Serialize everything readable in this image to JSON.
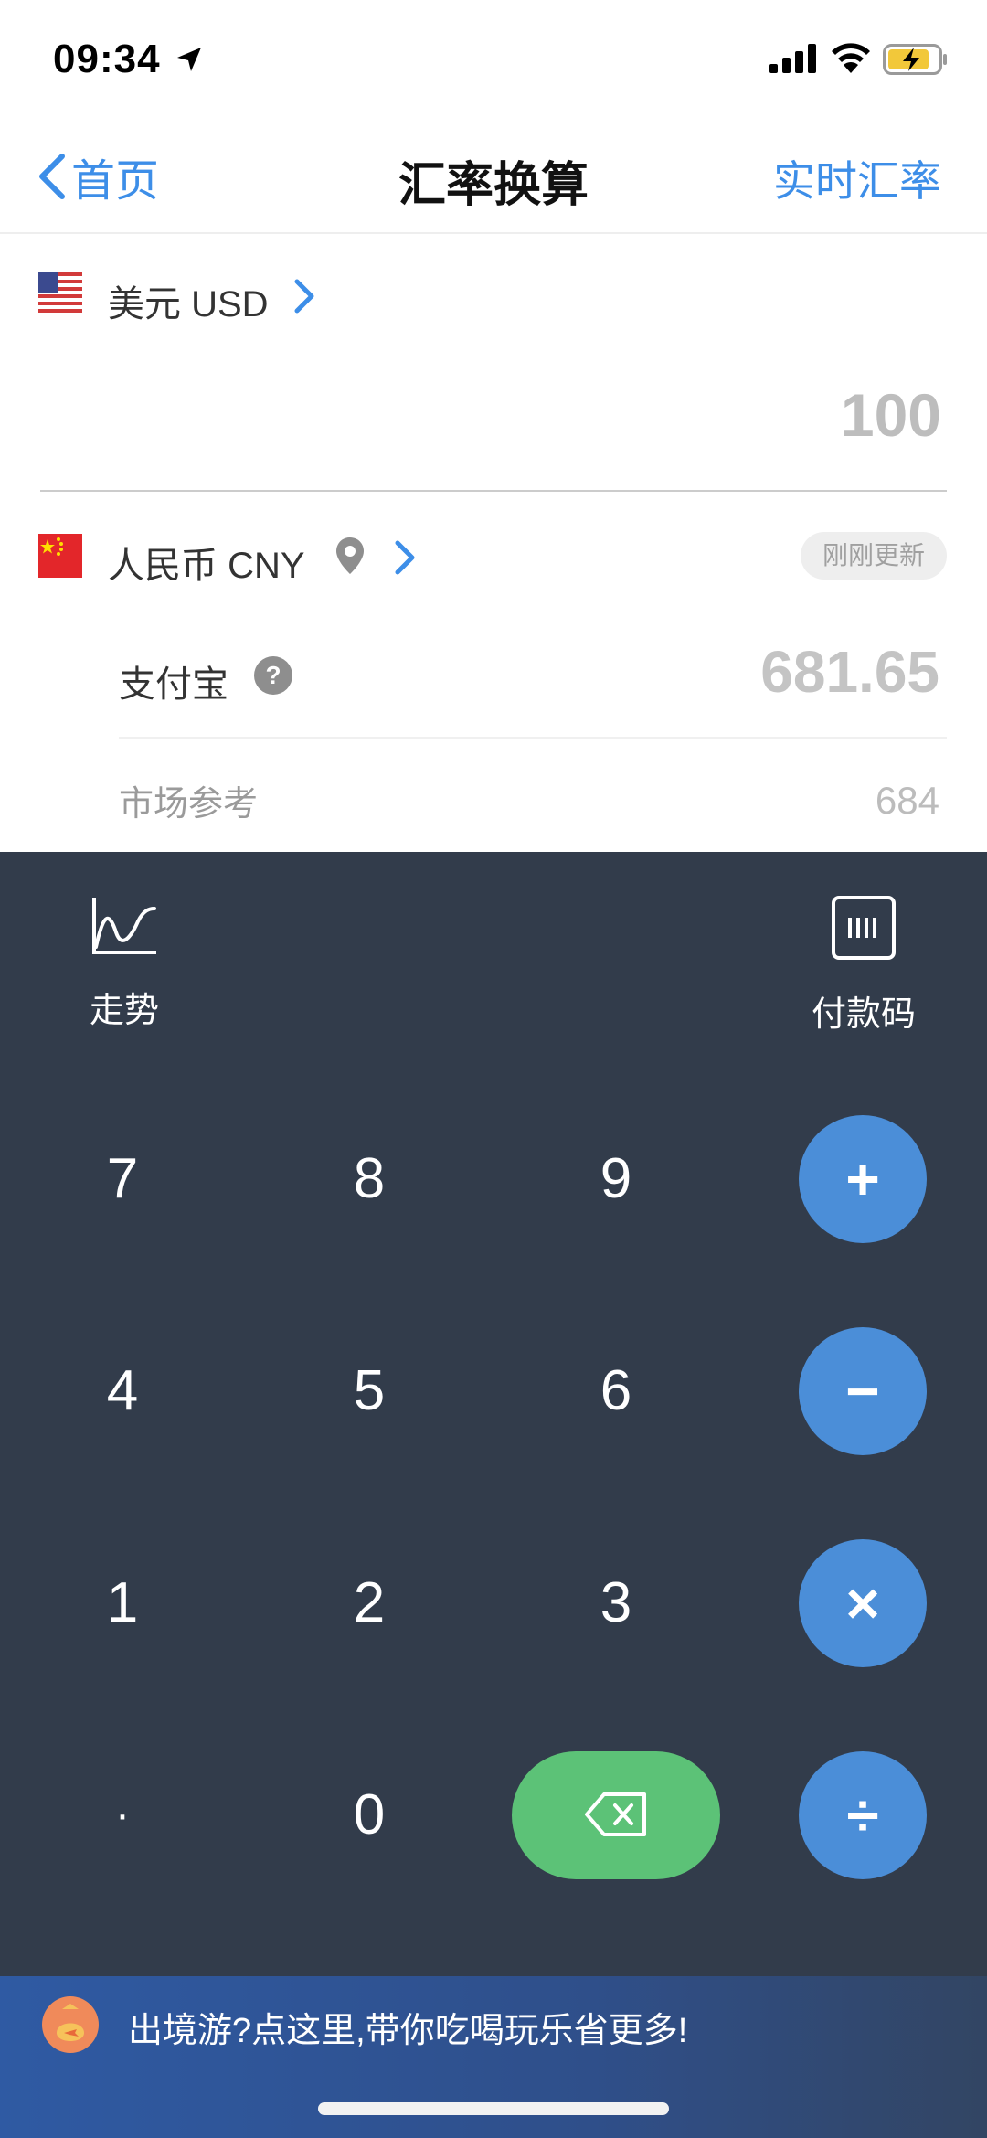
{
  "status_bar": {
    "time": "09:34"
  },
  "nav": {
    "back_label": "首页",
    "title": "汇率换算",
    "right_label": "实时汇率"
  },
  "from_currency": {
    "label": "美元 USD",
    "amount": "100",
    "flag": "us-flag"
  },
  "to_currency": {
    "label": "人民币 CNY",
    "flag": "cn-flag",
    "updated_badge": "刚刚更新",
    "alipay_label": "支付宝",
    "alipay_help": "?",
    "alipay_amount": "681.65",
    "market_label": "市场参考",
    "market_amount": "684"
  },
  "tools": {
    "trend_label": "走势",
    "paycode_label": "付款码"
  },
  "keys": {
    "k7": "7",
    "k8": "8",
    "k9": "9",
    "k4": "4",
    "k5": "5",
    "k6": "6",
    "k1": "1",
    "k2": "2",
    "k3": "3",
    "dot": "·",
    "k0": "0",
    "plus": "+",
    "minus": "−",
    "times": "×",
    "divide": "÷"
  },
  "banner": {
    "text": "出境游?点这里,带你吃喝玩乐省更多!"
  },
  "colors": {
    "accent": "#3d8ee8",
    "keypad_bg": "#323c4b",
    "operator": "#4b8ed8",
    "delete": "#5cc277"
  }
}
